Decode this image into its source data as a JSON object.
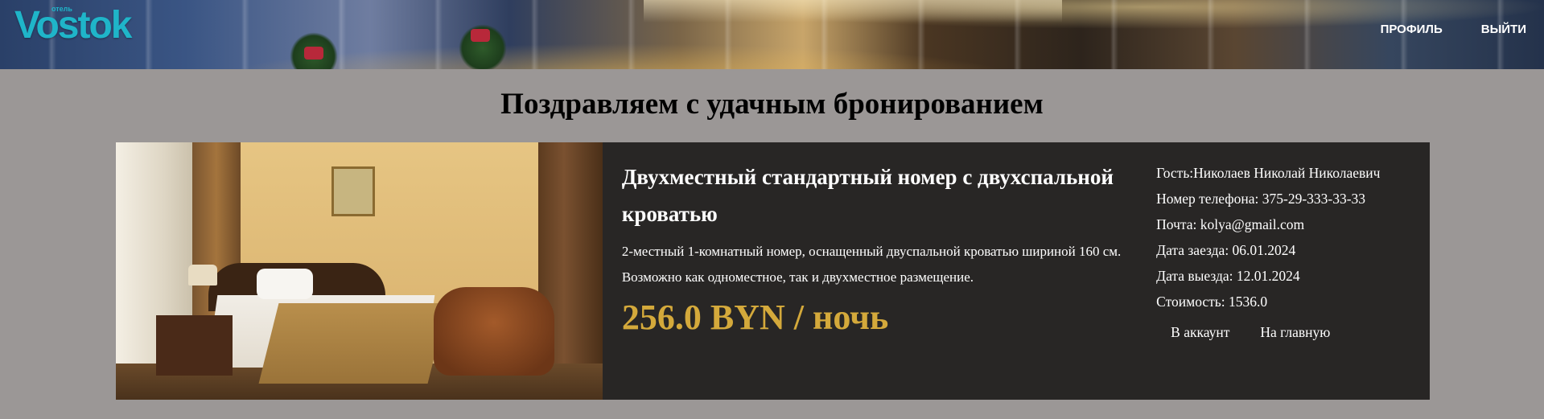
{
  "header": {
    "logo_small": "отель",
    "logo_text": "Vostok",
    "nav": {
      "profile": "ПРОФИЛЬ",
      "logout": "ВЫЙТИ"
    }
  },
  "page_title": "Поздравляем с удачным бронированием",
  "booking": {
    "room_title": "Двухместный стандартный номер с двухспальной кроватью",
    "description": "2-местный 1-комнатный номер, оснащенный двуспальной кроватью шириной 160 см. Возможно как одноместное, так и двухместное размещение.",
    "price": "256.0 BYN / ночь",
    "guest": "Гость:Николаев Николай Николаевич",
    "phone": "Номер телефона: 375-29-333-33-33",
    "email": "Почта: kolya@gmail.com",
    "checkin": "Дата заезда: 06.01.2024",
    "checkout": "Дата выезда: 12.01.2024",
    "cost": "Стоимость: 1536.0",
    "actions": {
      "account": "В аккаунт",
      "home": "На главную"
    }
  },
  "colors": {
    "page_bg": "#9b9796",
    "card_bg": "#282625",
    "price": "#d4a93b",
    "logo": "#1fb5c9"
  }
}
